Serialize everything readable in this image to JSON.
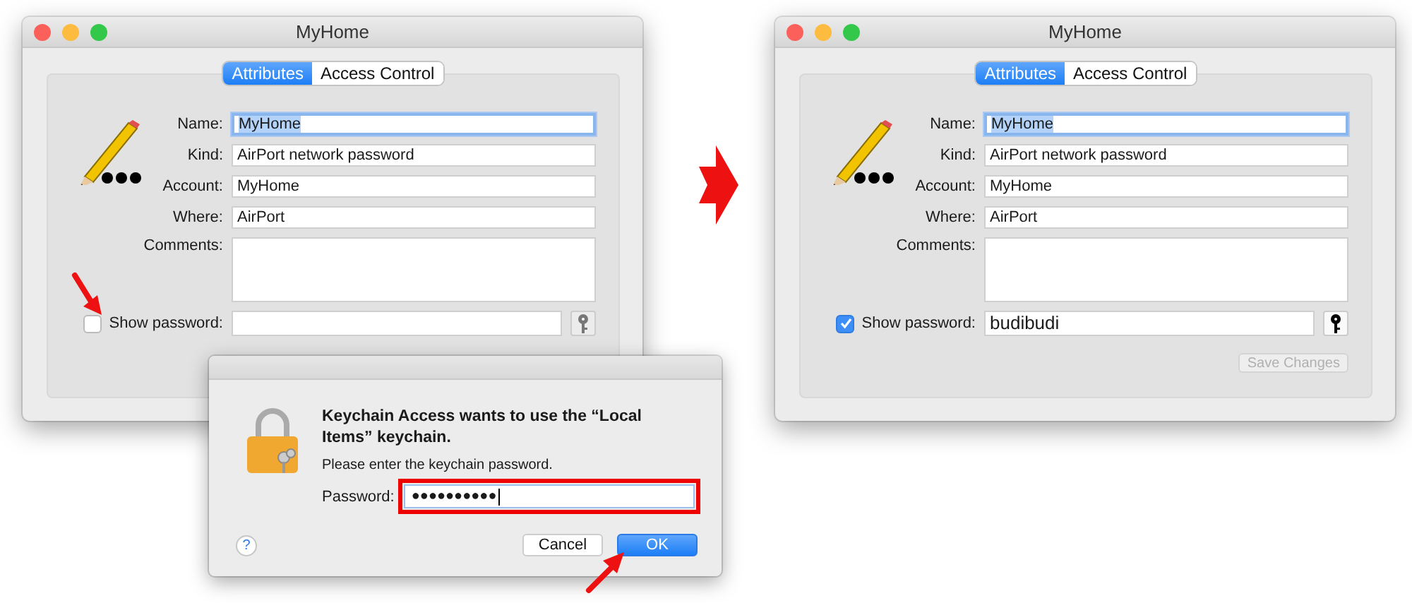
{
  "windows": [
    {
      "title": "MyHome",
      "tabs": [
        {
          "label": "Attributes",
          "selected": true
        },
        {
          "label": "Access Control",
          "selected": false
        }
      ],
      "fields": [
        {
          "label": "Name:",
          "value": "MyHome",
          "focused": true
        },
        {
          "label": "Kind:",
          "value": "AirPort network password",
          "focused": false
        },
        {
          "label": "Account:",
          "value": "MyHome",
          "focused": false
        },
        {
          "label": "Where:",
          "value": "AirPort",
          "focused": false
        }
      ],
      "comments": {
        "label": "Comments:"
      },
      "show_password": {
        "label": "Show password:",
        "checked": false
      },
      "key_button": {
        "disabled": true
      }
    },
    {
      "title": "MyHome",
      "tabs": [
        {
          "label": "Attributes",
          "selected": true
        },
        {
          "label": "Access Control",
          "selected": false
        }
      ],
      "fields": [
        {
          "label": "Name:",
          "value": "MyHome",
          "focused": true
        },
        {
          "label": "Kind:",
          "value": "AirPort network password",
          "focused": false
        },
        {
          "label": "Account:",
          "value": "MyHome",
          "focused": false
        },
        {
          "label": "Where:",
          "value": "AirPort",
          "focused": false
        }
      ],
      "comments": {
        "label": "Comments:"
      },
      "show_password": {
        "label": "Show password:",
        "checked": true,
        "value": "budibudi"
      },
      "key_button": {
        "disabled": false
      },
      "save_button": {
        "label": "Save Changes",
        "disabled": true
      }
    }
  ],
  "dialog": {
    "message": "Keychain Access wants to use the “Local Items” keychain.",
    "prompt": "Please enter the keychain password.",
    "password": {
      "label": "Password:",
      "value": "●●●●●●●●●●"
    },
    "help": "?",
    "buttons": [
      {
        "label": "Cancel",
        "default": false
      },
      {
        "label": "OK",
        "default": true
      }
    ]
  }
}
